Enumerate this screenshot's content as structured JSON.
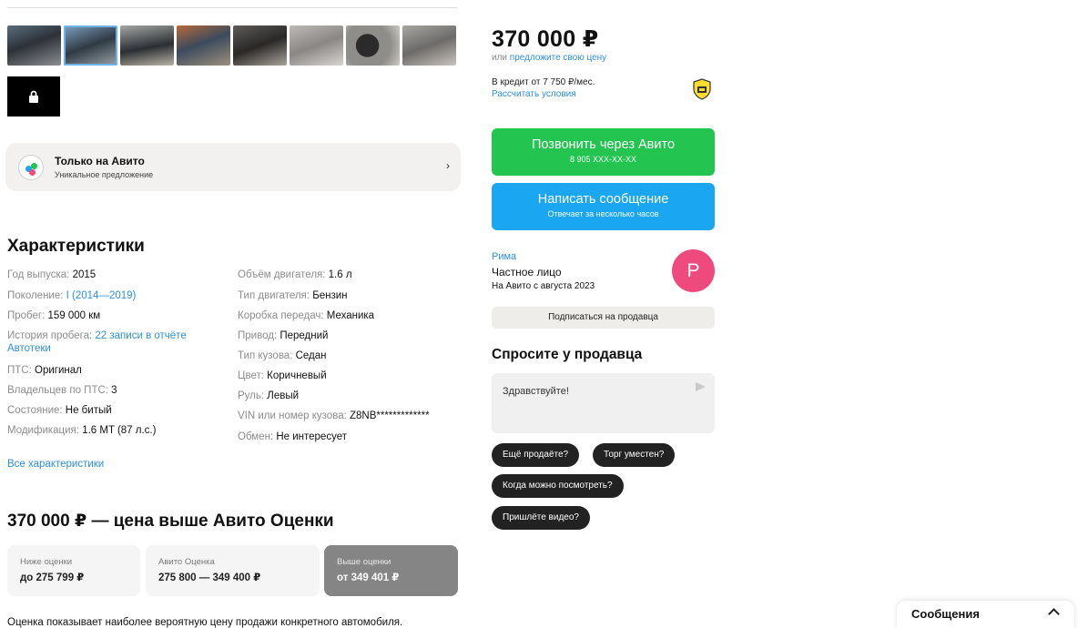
{
  "gallery": {
    "thumbnails": [
      "photo-1",
      "photo-2",
      "photo-3",
      "photo-4",
      "photo-5",
      "photo-6",
      "photo-7",
      "photo-8"
    ],
    "selected_index": 1
  },
  "promo": {
    "title": "Только на Авито",
    "subtitle": "Уникальное предложение",
    "arrow": "›"
  },
  "specs": {
    "title": "Характеристики",
    "left": [
      {
        "key": "Год выпуска: ",
        "value": "2015"
      },
      {
        "key": "Поколение: ",
        "value": "I (2014—2019)"
      },
      {
        "key": "Пробег: ",
        "value": "159 000 км"
      },
      {
        "key": "История пробега: ",
        "value": "22 записи в отчёте Автотеки"
      },
      {
        "key": "ПТС: ",
        "value": "Оригинал"
      },
      {
        "key": "Владельцев по ПТС: ",
        "value": "3"
      },
      {
        "key": "Состояние: ",
        "value": "Не битый"
      },
      {
        "key": "Модификация: ",
        "value": "1.6 MT (87 л.с.)"
      }
    ],
    "right": [
      {
        "key": "Объём двигателя: ",
        "value": "1.6 л"
      },
      {
        "key": "Тип двигателя: ",
        "value": "Бензин"
      },
      {
        "key": "Коробка передач: ",
        "value": "Механика"
      },
      {
        "key": "Привод: ",
        "value": "Передний"
      },
      {
        "key": "Тип кузова: ",
        "value": "Седан"
      },
      {
        "key": "Цвет: ",
        "value": "Коричневый"
      },
      {
        "key": "Руль: ",
        "value": "Левый"
      },
      {
        "key": "VIN или номер кузова: ",
        "value": "Z8NB*************"
      },
      {
        "key": "Обмен: ",
        "value": "Не интересует"
      }
    ],
    "all_link": "Все характеристики"
  },
  "evaluation": {
    "title": "370 000 ₽ — цена выше Авито Оценки",
    "boxes": [
      {
        "label": "Ниже оценки",
        "value": "до 275 799 ₽"
      },
      {
        "label": "Авито Оценка",
        "value": "275 800 — 349 400 ₽"
      },
      {
        "label": "Выше оценки",
        "value": "от 349 401 ₽"
      }
    ],
    "note": "Оценка показывает наиболее вероятную цену продажи конкретного автомобиля."
  },
  "sidebar": {
    "price": "370 000 ₽",
    "offer_prefix": "или ",
    "offer_link": "предложите свою цену",
    "credit_text": "В кредит от 7 750 ₽/мес.",
    "credit_link": "Рассчитать условия",
    "call_button": {
      "label": "Позвонить через Авито",
      "sub": "8 905 XXX-XX-XX"
    },
    "message_button": {
      "label": "Написать сообщение",
      "sub": "Отвечает за несколько часов"
    },
    "seller": {
      "name": "Рима",
      "type": "Частное лицо",
      "since": "На Авито с августа 2023",
      "avatar_letter": "P"
    },
    "subscribe_label": "Подписаться на продавца",
    "ask": {
      "title": "Спросите у продавца",
      "input_value": "Здравствуйте!",
      "chips": [
        "Ещё продаёте?",
        "Торг уместен?",
        "Когда можно посмотреть?",
        "Пришлёте видео?"
      ]
    }
  },
  "messenger": {
    "label": "Сообщения"
  },
  "colors": {
    "call_green": "#23c44f",
    "message_blue": "#1aa6f0",
    "link_blue": "#2d8fe0",
    "avatar_pink": "#ee4a7d"
  }
}
